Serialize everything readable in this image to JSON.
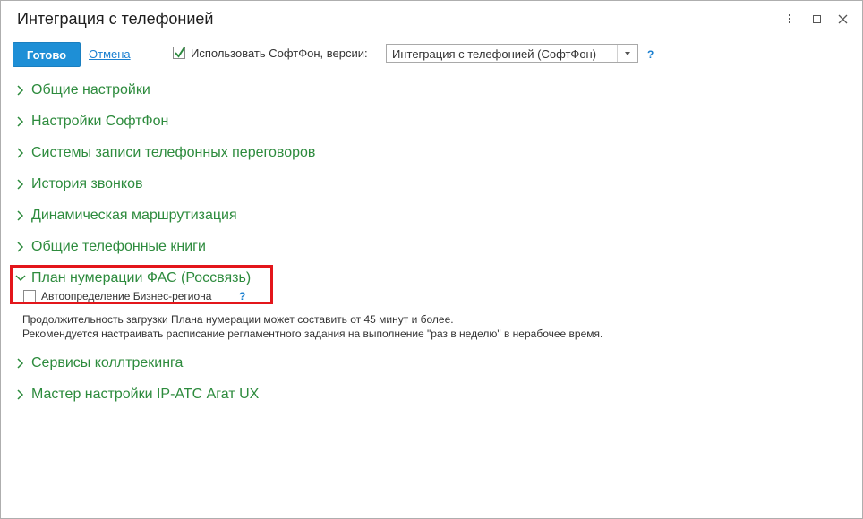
{
  "window": {
    "title": "Интеграция с телефонией"
  },
  "toolbar": {
    "done_label": "Готово",
    "cancel_label": "Отмена",
    "use_softfon_label": "Использовать СофтФон, версии:",
    "use_softfon_checked": true,
    "version_value": "Интеграция с телефонией (СофтФон)",
    "help_label": "?"
  },
  "groups": [
    {
      "label": "Общие настройки",
      "expanded": false
    },
    {
      "label": "Настройки СофтФон",
      "expanded": false
    },
    {
      "label": "Системы записи телефонных переговоров",
      "expanded": false
    },
    {
      "label": "История звонков",
      "expanded": false
    },
    {
      "label": "Динамическая маршрутизация",
      "expanded": false
    },
    {
      "label": "Общие телефонные книги",
      "expanded": false
    },
    {
      "label": "План нумерации ФАС (Россвязь)",
      "expanded": true
    },
    {
      "label": "Сервисы коллтрекинга",
      "expanded": false
    },
    {
      "label": "Мастер настройки IP-АТС Агат UX",
      "expanded": false
    }
  ],
  "numbering_plan": {
    "auto_region_label": "Автоопределение Бизнес-региона",
    "auto_region_checked": false,
    "help_label": "?",
    "note_line1": "Продолжительность загрузки Плана нумерации может составить от 45 минут и более.",
    "note_line2": "Рекомендуется настраивать расписание регламентного задания на выполнение \"раз в неделю\" в нерабочее время."
  },
  "colors": {
    "accent": "#1e8fd6",
    "group_text": "#2d8b3d",
    "link": "#1a7fd0",
    "highlight": "#e3161b"
  }
}
